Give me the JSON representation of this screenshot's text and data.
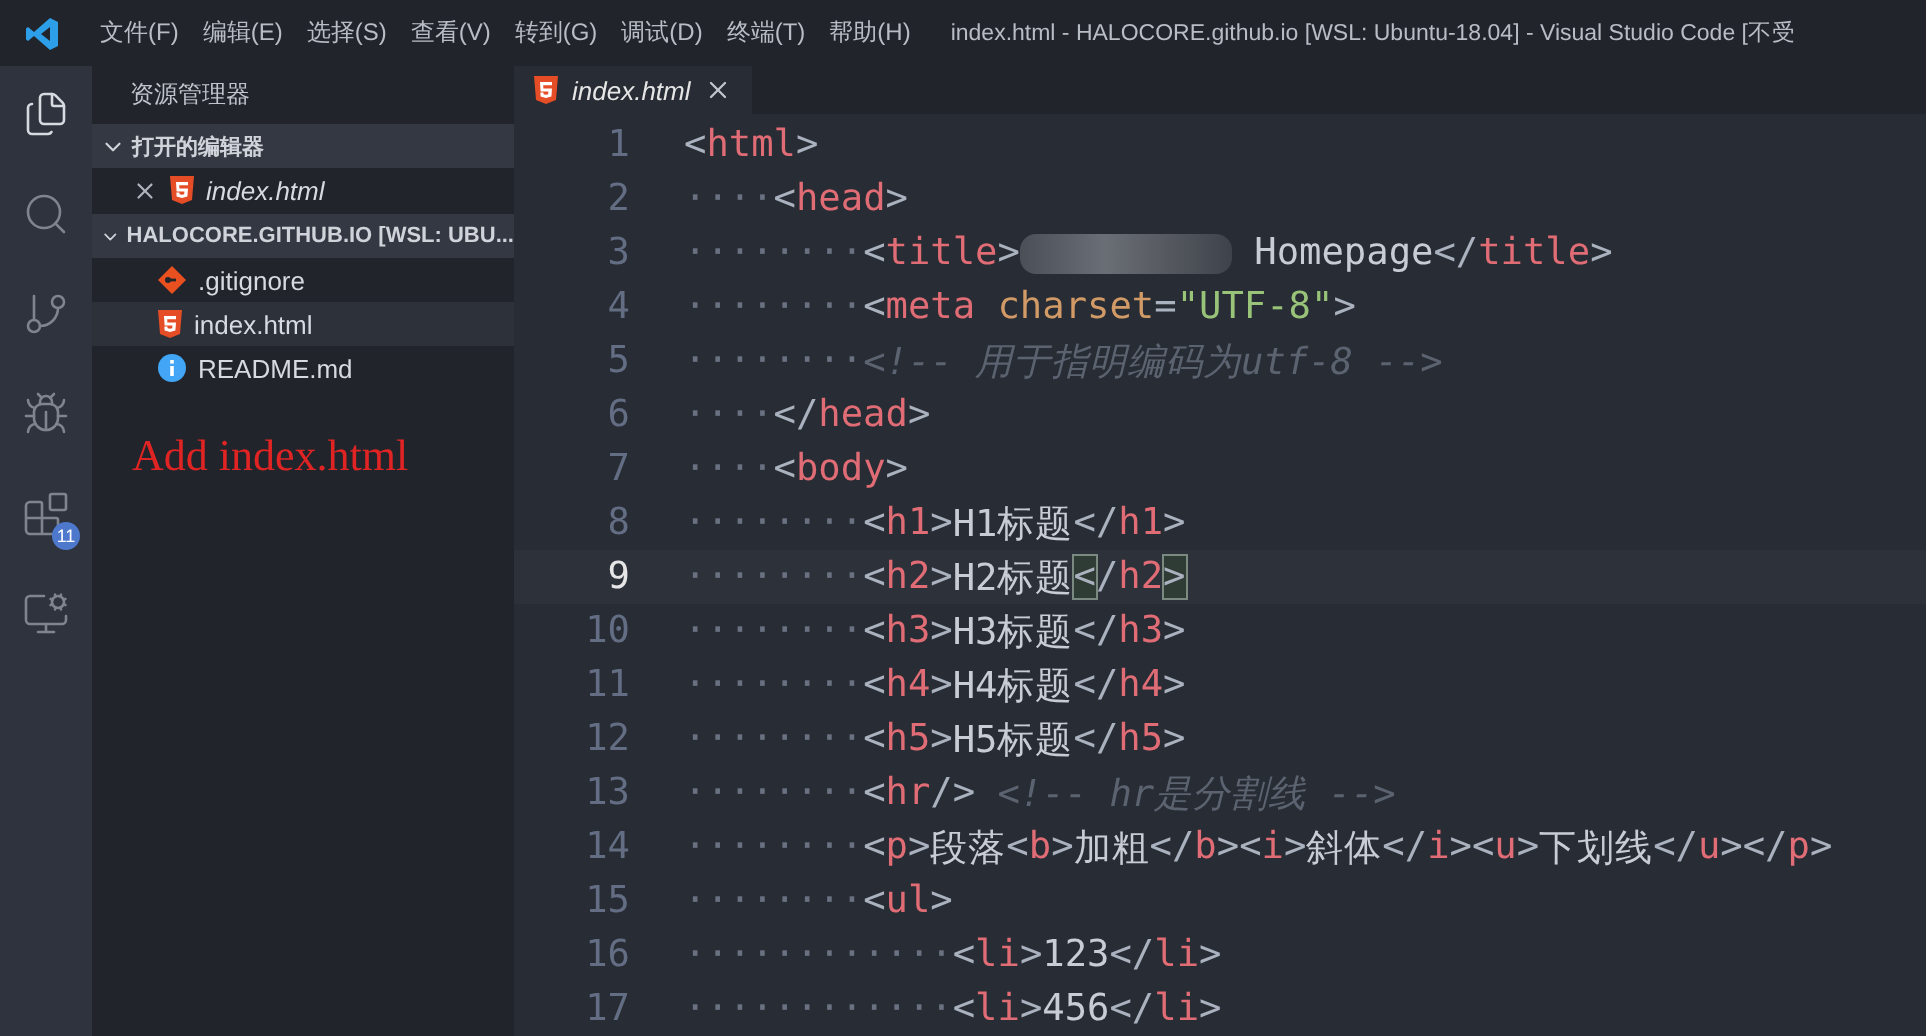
{
  "title_bar": {
    "menu": [
      "文件(F)",
      "编辑(E)",
      "选择(S)",
      "查看(V)",
      "转到(G)",
      "调试(D)",
      "终端(T)",
      "帮助(H)"
    ],
    "title": "index.html - HALOCORE.github.io [WSL: Ubuntu-18.04] - Visual Studio Code [不受"
  },
  "activity_bar": [
    {
      "kind": "files",
      "selected": true
    },
    {
      "kind": "search",
      "selected": false
    },
    {
      "kind": "git",
      "selected": false
    },
    {
      "kind": "debug",
      "selected": false
    },
    {
      "kind": "extensions",
      "selected": false,
      "badge": "11"
    },
    {
      "kind": "remote",
      "selected": false
    }
  ],
  "sidebar": {
    "title": "资源管理器",
    "sections": [
      {
        "title": "打开的编辑器",
        "expanded": true,
        "items": [
          {
            "name": "index.html",
            "kind": "html",
            "open_editor": true,
            "selected": false
          }
        ]
      },
      {
        "title": "HALOCORE.GITHUB.IO [WSL: UBU...",
        "expanded": true,
        "items": [
          {
            "name": ".gitignore",
            "kind": "git",
            "open_editor": false,
            "selected": false
          },
          {
            "name": "index.html",
            "kind": "html",
            "open_editor": false,
            "selected": true
          },
          {
            "name": "README.md",
            "kind": "info",
            "open_editor": false,
            "selected": false
          }
        ]
      }
    ],
    "annotation": "Add index.html"
  },
  "tabs": [
    {
      "label": "index.html",
      "kind": "html",
      "selected": true
    }
  ],
  "editor": {
    "lines": [
      {
        "number": "1",
        "current": false,
        "tokens": [
          {
            "kind": "punct",
            "text": "<"
          },
          {
            "kind": "tag",
            "text": "html"
          },
          {
            "kind": "punct",
            "text": ">"
          }
        ]
      },
      {
        "number": "2",
        "current": false,
        "tokens": [
          {
            "kind": "whitespace",
            "text": "····"
          },
          {
            "kind": "punct",
            "text": "<"
          },
          {
            "kind": "tag",
            "text": "head"
          },
          {
            "kind": "punct",
            "text": ">"
          }
        ]
      },
      {
        "number": "3",
        "current": false,
        "tokens": [
          {
            "kind": "whitespace",
            "text": "········"
          },
          {
            "kind": "punct",
            "text": "<"
          },
          {
            "kind": "tag",
            "text": "title"
          },
          {
            "kind": "punct",
            "text": ">"
          },
          {
            "kind": "redacted"
          },
          {
            "kind": "text",
            "text": " Homepage"
          },
          {
            "kind": "punct",
            "text": "</"
          },
          {
            "kind": "tag",
            "text": "title"
          },
          {
            "kind": "punct",
            "text": ">"
          }
        ]
      },
      {
        "number": "4",
        "current": false,
        "tokens": [
          {
            "kind": "whitespace",
            "text": "········"
          },
          {
            "kind": "punct",
            "text": "<"
          },
          {
            "kind": "tag",
            "text": "meta"
          },
          {
            "kind": "attr",
            "text": " charset"
          },
          {
            "kind": "punct",
            "text": "="
          },
          {
            "kind": "string",
            "text": "\"UTF-8\""
          },
          {
            "kind": "punct",
            "text": ">"
          }
        ]
      },
      {
        "number": "5",
        "current": false,
        "tokens": [
          {
            "kind": "whitespace",
            "text": "········"
          },
          {
            "kind": "comment",
            "text": "<!-- 用于指明编码为utf-8 -->"
          }
        ]
      },
      {
        "number": "6",
        "current": false,
        "tokens": [
          {
            "kind": "whitespace",
            "text": "····"
          },
          {
            "kind": "punct",
            "text": "</"
          },
          {
            "kind": "tag",
            "text": "head"
          },
          {
            "kind": "punct",
            "text": ">"
          }
        ]
      },
      {
        "number": "7",
        "current": false,
        "tokens": [
          {
            "kind": "whitespace",
            "text": "····"
          },
          {
            "kind": "punct",
            "text": "<"
          },
          {
            "kind": "tag",
            "text": "body"
          },
          {
            "kind": "punct",
            "text": ">"
          }
        ]
      },
      {
        "number": "8",
        "current": false,
        "tokens": [
          {
            "kind": "whitespace",
            "text": "········"
          },
          {
            "kind": "punct",
            "text": "<"
          },
          {
            "kind": "tag",
            "text": "h1"
          },
          {
            "kind": "punct",
            "text": ">"
          },
          {
            "kind": "text",
            "text": "H1标题"
          },
          {
            "kind": "punct",
            "text": "</"
          },
          {
            "kind": "tag",
            "text": "h1"
          },
          {
            "kind": "punct",
            "text": ">"
          }
        ]
      },
      {
        "number": "9",
        "current": true,
        "tokens": [
          {
            "kind": "whitespace",
            "text": "········"
          },
          {
            "kind": "punct",
            "text": "<"
          },
          {
            "kind": "tag",
            "text": "h2"
          },
          {
            "kind": "punct",
            "text": ">"
          },
          {
            "kind": "text",
            "text": "H2标题"
          },
          {
            "kind": "bracket_match",
            "text": "<"
          },
          {
            "kind": "punct",
            "text": "/"
          },
          {
            "kind": "tag",
            "text": "h2"
          },
          {
            "kind": "bracket_match",
            "text": ">"
          }
        ]
      },
      {
        "number": "10",
        "current": false,
        "tokens": [
          {
            "kind": "whitespace",
            "text": "········"
          },
          {
            "kind": "punct",
            "text": "<"
          },
          {
            "kind": "tag",
            "text": "h3"
          },
          {
            "kind": "punct",
            "text": ">"
          },
          {
            "kind": "text",
            "text": "H3标题"
          },
          {
            "kind": "punct",
            "text": "</"
          },
          {
            "kind": "tag",
            "text": "h3"
          },
          {
            "kind": "punct",
            "text": ">"
          }
        ]
      },
      {
        "number": "11",
        "current": false,
        "tokens": [
          {
            "kind": "whitespace",
            "text": "········"
          },
          {
            "kind": "punct",
            "text": "<"
          },
          {
            "kind": "tag",
            "text": "h4"
          },
          {
            "kind": "punct",
            "text": ">"
          },
          {
            "kind": "text",
            "text": "H4标题"
          },
          {
            "kind": "punct",
            "text": "</"
          },
          {
            "kind": "tag",
            "text": "h4"
          },
          {
            "kind": "punct",
            "text": ">"
          }
        ]
      },
      {
        "number": "12",
        "current": false,
        "tokens": [
          {
            "kind": "whitespace",
            "text": "········"
          },
          {
            "kind": "punct",
            "text": "<"
          },
          {
            "kind": "tag",
            "text": "h5"
          },
          {
            "kind": "punct",
            "text": ">"
          },
          {
            "kind": "text",
            "text": "H5标题"
          },
          {
            "kind": "punct",
            "text": "</"
          },
          {
            "kind": "tag",
            "text": "h5"
          },
          {
            "kind": "punct",
            "text": ">"
          }
        ]
      },
      {
        "number": "13",
        "current": false,
        "tokens": [
          {
            "kind": "whitespace",
            "text": "········"
          },
          {
            "kind": "punct",
            "text": "<"
          },
          {
            "kind": "tag",
            "text": "hr"
          },
          {
            "kind": "punct",
            "text": "/>"
          },
          {
            "kind": "comment",
            "text": " <!-- hr是分割线 -->"
          }
        ]
      },
      {
        "number": "14",
        "current": false,
        "tokens": [
          {
            "kind": "whitespace",
            "text": "········"
          },
          {
            "kind": "punct",
            "text": "<"
          },
          {
            "kind": "tag",
            "text": "p"
          },
          {
            "kind": "punct",
            "text": ">"
          },
          {
            "kind": "text",
            "text": "段落"
          },
          {
            "kind": "punct",
            "text": "<"
          },
          {
            "kind": "tag",
            "text": "b"
          },
          {
            "kind": "punct",
            "text": ">"
          },
          {
            "kind": "text",
            "text": "加粗"
          },
          {
            "kind": "punct",
            "text": "</"
          },
          {
            "kind": "tag",
            "text": "b"
          },
          {
            "kind": "punct",
            "text": "><"
          },
          {
            "kind": "tag",
            "text": "i"
          },
          {
            "kind": "punct",
            "text": ">"
          },
          {
            "kind": "text",
            "text": "斜体"
          },
          {
            "kind": "punct",
            "text": "</"
          },
          {
            "kind": "tag",
            "text": "i"
          },
          {
            "kind": "punct",
            "text": "><"
          },
          {
            "kind": "tag",
            "text": "u"
          },
          {
            "kind": "punct",
            "text": ">"
          },
          {
            "kind": "text",
            "text": "下划线"
          },
          {
            "kind": "punct",
            "text": "</"
          },
          {
            "kind": "tag",
            "text": "u"
          },
          {
            "kind": "punct",
            "text": "></"
          },
          {
            "kind": "tag",
            "text": "p"
          },
          {
            "kind": "punct",
            "text": ">"
          }
        ]
      },
      {
        "number": "15",
        "current": false,
        "tokens": [
          {
            "kind": "whitespace",
            "text": "········"
          },
          {
            "kind": "punct",
            "text": "<"
          },
          {
            "kind": "tag",
            "text": "ul"
          },
          {
            "kind": "punct",
            "text": ">"
          }
        ]
      },
      {
        "number": "16",
        "current": false,
        "tokens": [
          {
            "kind": "whitespace",
            "text": "············"
          },
          {
            "kind": "punct",
            "text": "<"
          },
          {
            "kind": "tag",
            "text": "li"
          },
          {
            "kind": "punct",
            "text": ">"
          },
          {
            "kind": "text",
            "text": "123"
          },
          {
            "kind": "punct",
            "text": "</"
          },
          {
            "kind": "tag",
            "text": "li"
          },
          {
            "kind": "punct",
            "text": ">"
          }
        ]
      },
      {
        "number": "17",
        "current": false,
        "tokens": [
          {
            "kind": "whitespace",
            "text": "············"
          },
          {
            "kind": "punct",
            "text": "<"
          },
          {
            "kind": "tag",
            "text": "li"
          },
          {
            "kind": "punct",
            "text": ">"
          },
          {
            "kind": "text",
            "text": "456"
          },
          {
            "kind": "punct",
            "text": "</"
          },
          {
            "kind": "tag",
            "text": "li"
          },
          {
            "kind": "punct",
            "text": ">"
          }
        ]
      }
    ]
  }
}
